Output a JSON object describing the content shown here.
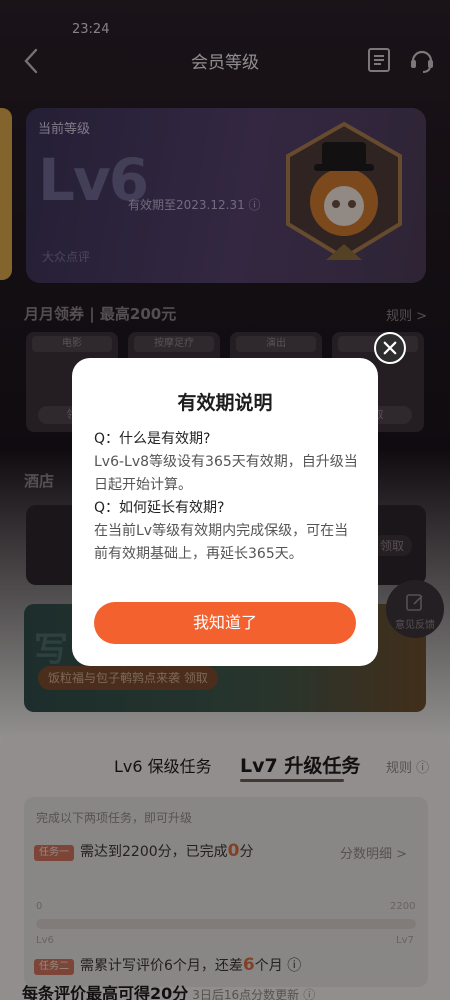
{
  "status": {
    "time": "23:24"
  },
  "header": {
    "title": "会员等级"
  },
  "level_card": {
    "label": "当前等级",
    "level": "Lv6",
    "validity": "有效期至2023.12.31",
    "brand": "大众点评"
  },
  "coupons": {
    "title": "月月领券 | 最高200元",
    "rule_label": "规则 >",
    "items": [
      {
        "title": "电影",
        "action": "领"
      },
      {
        "title": "按摩足疗",
        "action": ""
      },
      {
        "title": "演出",
        "action": ""
      },
      {
        "title": "",
        "action": "取"
      }
    ]
  },
  "hotel": {
    "title": "酒店",
    "action": "领取"
  },
  "banner": {
    "bg_text": "写",
    "pill_text": "饭粒福与包子鹌鹑点来袭 领取"
  },
  "feedback": {
    "label": "意见反馈"
  },
  "tasks": {
    "tab_keep": "Lv6 保级任务",
    "tab_upgrade": "Lv7 升级任务",
    "rule_label": "规则",
    "hint": "完成以下两项任务，即可升级",
    "task1": {
      "tag": "任务一",
      "pre": "需达到2200分，已完成",
      "value": "0",
      "post": "分",
      "link": "分数明细 >"
    },
    "progress": {
      "min": "0",
      "max": "2200",
      "from": "Lv6",
      "to": "Lv7",
      "value": 0
    },
    "task2": {
      "tag": "任务二",
      "pre": "需累计写评价6个月，还差",
      "value": "6",
      "post": "个月"
    },
    "footer_title": "每条评价最高可得20分",
    "footer_sub": "3日后16点分数更新"
  },
  "modal": {
    "title": "有效期说明",
    "q1": "Q：什么是有效期?",
    "a1": "Lv6-Lv8等级设有365天有效期，自升级当日起开始计算。",
    "q2": "Q：如何延长有效期?",
    "a2": "在当前Lv等级有效期内完成保级，可在当前有效期基础上，再延长365天。",
    "confirm": "我知道了"
  }
}
